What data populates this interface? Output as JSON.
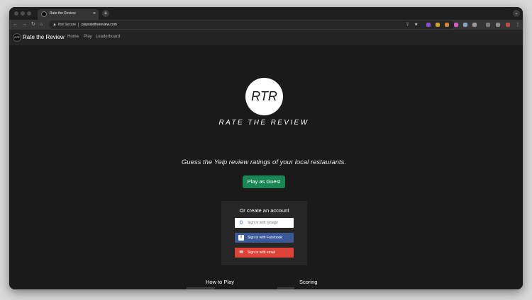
{
  "browser": {
    "tab_title": "Rate the Review",
    "tab_close": "×",
    "new_tab": "+",
    "tab_menu": "⌄",
    "security_label": "Not Secure",
    "url": "playratethereview.com"
  },
  "site": {
    "logo_text": "RTR",
    "brand": "Rate the Review",
    "nav": [
      "Home",
      "Play",
      "Leaderboard"
    ]
  },
  "hero": {
    "logo_text": "RTR",
    "wordmark": "RATE THE REVIEW",
    "tagline": "Guess the Yelp review ratings of your local restaurants."
  },
  "guest_button": "Play as Guest",
  "auth": {
    "title": "Or create an account",
    "google": "Sign in with Google",
    "facebook": "Sign in with Facebook",
    "email": "Sign in with email"
  },
  "sections": {
    "how_to_play": "How to Play",
    "scoring": "Scoring"
  },
  "colors": {
    "guest_green": "#198754",
    "facebook_blue": "#3b5998",
    "email_red": "#db4437"
  }
}
